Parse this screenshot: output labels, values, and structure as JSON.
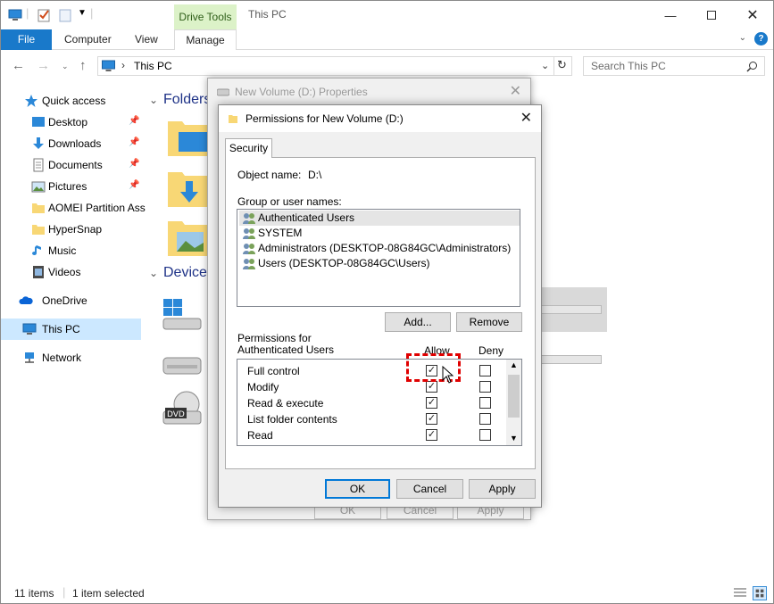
{
  "explorer": {
    "window_title": "This PC",
    "context_tab": "Drive Tools",
    "tabs": [
      "File",
      "Computer",
      "View",
      "Manage"
    ],
    "address": "This PC",
    "search_placeholder": "Search This PC",
    "sidebar": [
      {
        "label": "Quick access",
        "icon": "star-icon"
      },
      {
        "label": "Desktop",
        "icon": "desktop-icon",
        "pinned": true
      },
      {
        "label": "Downloads",
        "icon": "download-icon",
        "pinned": true
      },
      {
        "label": "Documents",
        "icon": "documents-icon",
        "pinned": true
      },
      {
        "label": "Pictures",
        "icon": "pictures-icon",
        "pinned": true
      },
      {
        "label": "AOMEI Partition Ass",
        "icon": "folder-icon"
      },
      {
        "label": "HyperSnap",
        "icon": "folder-icon"
      },
      {
        "label": "Music",
        "icon": "music-icon"
      },
      {
        "label": "Videos",
        "icon": "videos-icon"
      },
      {
        "label": "OneDrive",
        "icon": "cloud-icon"
      },
      {
        "label": "This PC",
        "icon": "computer-icon",
        "selected": true
      },
      {
        "label": "Network",
        "icon": "network-icon"
      }
    ],
    "groups": [
      "Folders",
      "Devices"
    ],
    "status": {
      "items": "11 items",
      "selected": "1 item selected"
    }
  },
  "properties_dialog": {
    "title": "New Volume (D:) Properties",
    "buttons": [
      "OK",
      "Cancel",
      "Apply"
    ]
  },
  "permissions_dialog": {
    "title": "Permissions for New Volume (D:)",
    "tab": "Security",
    "object_name_label": "Object name:",
    "object_name_value": "D:\\",
    "group_label": "Group or user names:",
    "users": [
      "Authenticated Users",
      "SYSTEM",
      "Administrators (DESKTOP-08G84GC\\Administrators)",
      "Users (DESKTOP-08G84GC\\Users)"
    ],
    "add_button": "Add...",
    "remove_button": "Remove",
    "permissions_label": "Permissions for Authenticated Users",
    "allow_header": "Allow",
    "deny_header": "Deny",
    "permissions": [
      {
        "name": "Full control",
        "allow": true,
        "deny": false
      },
      {
        "name": "Modify",
        "allow": true,
        "deny": false
      },
      {
        "name": "Read & execute",
        "allow": true,
        "deny": false
      },
      {
        "name": "List folder contents",
        "allow": true,
        "deny": false
      },
      {
        "name": "Read",
        "allow": true,
        "deny": false
      }
    ],
    "ok_button": "OK",
    "cancel_button": "Cancel",
    "apply_button": "Apply"
  },
  "colors": {
    "accent": "#0078d7",
    "file_tab": "#1979ca",
    "drive_tools": "#dcf2c8",
    "highlight": "#e00000"
  }
}
